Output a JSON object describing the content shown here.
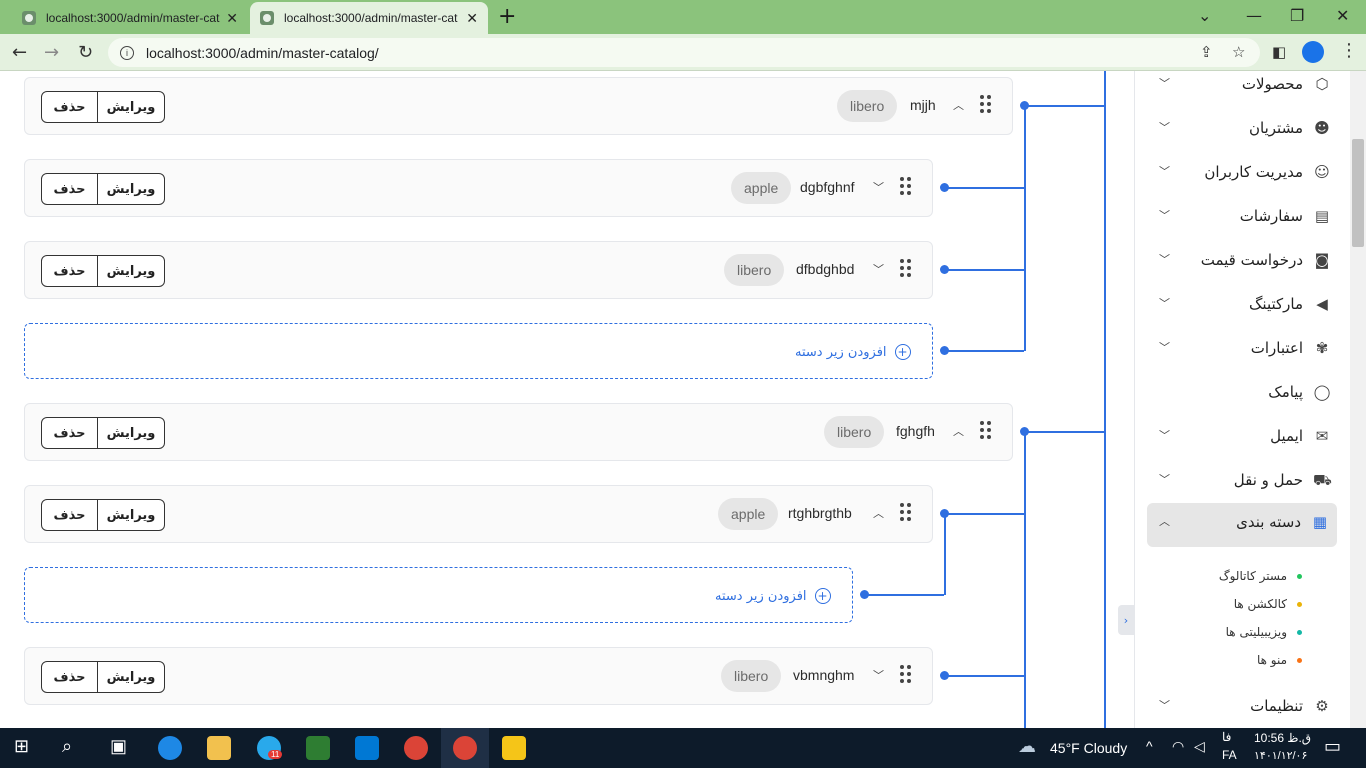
{
  "browser": {
    "tabs": [
      {
        "title": "localhost:3000/admin/master-cat"
      },
      {
        "title": "localhost:3000/admin/master-cat"
      }
    ],
    "url": "localhost:3000/admin/master-catalog/"
  },
  "tree": {
    "edit_label": "ویرایش",
    "delete_label": "حذف",
    "add_sub_label": "افزودن زیر دسته",
    "rows": [
      {
        "name": "mjjh",
        "tag": "libero",
        "expanded": true
      },
      {
        "name": "dgbfghnf",
        "tag": "apple",
        "expanded": false
      },
      {
        "name": "dfbdghbd",
        "tag": "libero",
        "expanded": false
      },
      {
        "name": "fghgfh",
        "tag": "libero",
        "expanded": true
      },
      {
        "name": "rtghbrgthb",
        "tag": "apple",
        "expanded": true
      },
      {
        "name": "vbmnghm",
        "tag": "libero",
        "expanded": false
      }
    ]
  },
  "sidebar": {
    "items": [
      {
        "label": "محصولات",
        "icon": "box-icon"
      },
      {
        "label": "مشتریان",
        "icon": "users-icon"
      },
      {
        "label": "مدیریت کاربران",
        "icon": "user-group-icon"
      },
      {
        "label": "سفارشات",
        "icon": "clipboard-icon"
      },
      {
        "label": "درخواست قیمت",
        "icon": "camera-icon"
      },
      {
        "label": "مارکتینگ",
        "icon": "megaphone-icon"
      },
      {
        "label": "اعتبارات",
        "icon": "badge-icon"
      },
      {
        "label": "پیامک",
        "icon": "chat-icon"
      },
      {
        "label": "ایمیل",
        "icon": "mail-icon"
      },
      {
        "label": "حمل و نقل",
        "icon": "truck-icon"
      },
      {
        "label": "دسته بندی",
        "icon": "grid-icon"
      },
      {
        "label": "تنظیمات",
        "icon": "gear-icon"
      }
    ],
    "subitems": [
      {
        "label": "مستر کاتالوگ",
        "color": "#22c55e"
      },
      {
        "label": "کالکشن ها",
        "color": "#eab308"
      },
      {
        "label": "ویزیبیلیتی ها",
        "color": "#14b8a6"
      },
      {
        "label": "منو ها",
        "color": "#f97316"
      }
    ]
  },
  "taskbar": {
    "weather": "45°F  Cloudy",
    "time": "10:56 ق.ظ",
    "date": "۱۴۰۱/۱۲/۰۶",
    "lang": "FA",
    "lang2": "فا",
    "telegram_badge": "11"
  }
}
